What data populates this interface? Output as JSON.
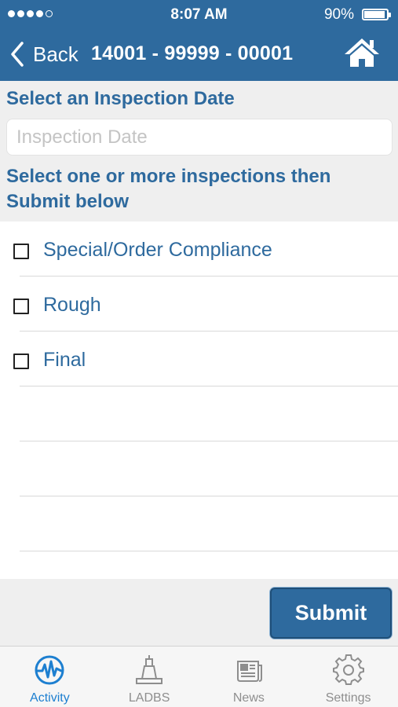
{
  "status_bar": {
    "time": "8:07 AM",
    "battery_percent": "90%",
    "battery_level": 0.9,
    "signal_bars_filled": 4,
    "signal_bars_total": 5
  },
  "nav": {
    "back_label": "Back",
    "title": "14001 - 99999 - 00001",
    "home_icon": "home-icon"
  },
  "date_section": {
    "title": "Select an Inspection Date",
    "placeholder": "Inspection Date",
    "value": ""
  },
  "instruction": "Select one or more inspections then Submit below",
  "inspections": [
    {
      "label": "Special/Order Compliance",
      "checked": false
    },
    {
      "label": "Rough",
      "checked": false
    },
    {
      "label": "Final",
      "checked": false
    }
  ],
  "submit_label": "Submit",
  "tabs": [
    {
      "label": "Activity",
      "icon": "activity-icon",
      "active": true
    },
    {
      "label": "LADBS",
      "icon": "ladbs-building-icon",
      "active": false
    },
    {
      "label": "News",
      "icon": "news-icon",
      "active": false
    },
    {
      "label": "Settings",
      "icon": "gear-icon",
      "active": false
    }
  ],
  "colors": {
    "primary": "#2e6a9e",
    "active_tab": "#1d7fd0",
    "inactive_tab": "#8e8e8e",
    "section_bg": "#efefef"
  }
}
